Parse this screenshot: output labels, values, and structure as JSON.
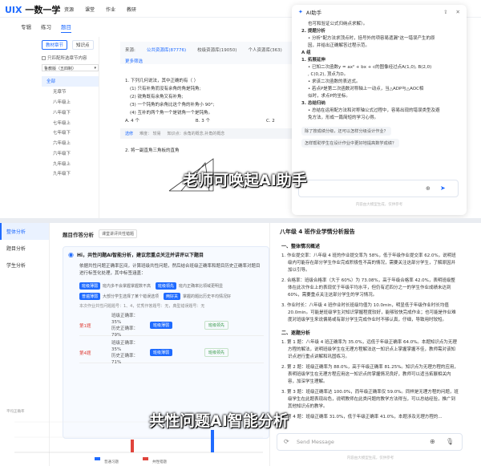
{
  "header": {
    "logo_mark": "UIX",
    "logo_text": "一数一学",
    "nav": [
      "资源",
      "课堂",
      "作业",
      "教研"
    ],
    "tabs": [
      "专辑",
      "练习",
      "题目"
    ]
  },
  "left_filter": {
    "subtabs": [
      "教材章节",
      "知识点"
    ],
    "only_matching": "只匹配所选章节内容",
    "edition": "鲁教版（五四制）",
    "tree": [
      "全部",
      "无章节",
      "八年级上",
      "八年级下",
      "七年级上",
      "七年级下",
      "六年级上",
      "六年级下",
      "九年级上",
      "九年级下"
    ]
  },
  "question_area": {
    "source_label": "来源:",
    "sources": [
      "公共资源库(87776)",
      "校级资源库(19050)",
      "个人资源库(363)"
    ],
    "more": "更多筛选",
    "q1": "1.  下列几何说法，其中正确的有（      ）",
    "q1_items": [
      "(1) 只有补角而没有余角的角是钝角;",
      "(2) 锐角既有余角又有补角;",
      "(3) 一个钝角的余角比这个角的补角小 90°;",
      "(4) 互补的两个角一个是锐角一个是钝角。"
    ],
    "q1_opts": [
      "A. 4 个",
      "B. 3 个",
      "C. 2"
    ],
    "q1_meta": [
      "选修",
      "难度：  较易",
      "知识点：余角的概念,补角的概念"
    ],
    "q2": "2.  将一副直角三角板的直角"
  },
  "ai_panel": {
    "title": "AI助手",
    "lines": [
      {
        "t": "也可和验证公式归纳点求解）。",
        "cls": "ind"
      },
      {
        "t": "2. 提题分析",
        "cls": "b"
      },
      {
        "t": "• 分析\"配方法求顶点时，括号外的项容易遗漏\"这一错误产生的原",
        "cls": "ind"
      },
      {
        "t": "因，并给出正确解答过程示范。",
        "cls": "ind"
      },
      {
        "t": "A 组",
        "cls": "b"
      },
      {
        "t": "1. 拓展延伸",
        "cls": "b"
      },
      {
        "t": "• 已知二次函数y = ax² + bx + c的图像经过点A(1,0), B(2,0)",
        "cls": "ind"
      },
      {
        "t": ", C(0,2), 顶点为D。",
        "cls": "ind"
      },
      {
        "t": "• 求该二次函数的表达式。",
        "cls": "ind"
      },
      {
        "t": "• 若点P是第二次函数对称轴上一动点，当△ADP与△AOC相",
        "cls": "ind"
      },
      {
        "t": "似时，求点P的坐标。",
        "cls": "ind"
      },
      {
        "t": "3. 总结归纳",
        "cls": "b"
      },
      {
        "t": "• 总结在运用配方法和对称轴公式过程中，容易出现的错误类型及避",
        "cls": "ind"
      },
      {
        "t": "免方法，形成一篇简短的学习心得。",
        "cls": "ind"
      }
    ],
    "suggestions": [
      "除了按成绩分级，还可以怎样分级设计作业？",
      "怎样帮助学生在设计作业中更好地提高数学成绩？"
    ],
    "footer": "内容由大模型生成，仅供参考"
  },
  "captions": {
    "top": "老师可唤起AI助手",
    "bottom": "共性问题AI智能分析"
  },
  "analysis": {
    "side": [
      "整体分析",
      "题目分析",
      "学生分析"
    ],
    "title": "题目作答分析",
    "pill": "课堂讲评共性错题",
    "ai_head": "Hi，共性问题AI智能分析，建议您重点关注并讲评以下题目",
    "intro": "依据共性问题正确率区间，计算班级共性问题，然后结合班级正确率和题目历史正确率对题目进行标签化处理，其中标签涵盖：",
    "chips": [
      {
        "t": "班级薄弱",
        "d": "班内多不会掌握掌握数不高"
      },
      {
        "t": "班级领先",
        "d": "班内正确率比领域更明显"
      },
      {
        "t": "普遍薄弱",
        "d": "大部分学生选择了某个错误选项"
      },
      {
        "t": "两好关",
        "d": "掌握的题比历史平均情况好"
      }
    ],
    "students": "本次作业共性问题题号：1、4，优秀作答题号：无，典型错误题号：无",
    "rows": [
      {
        "q": "第1题",
        "class": "班级正确率：35%",
        "hist": "历史正确率：79%",
        "b1": "班级薄弱",
        "b2": "班级领先"
      },
      {
        "q": "第4题",
        "class": "班级正确率：35%",
        "hist": "历史正确率：71%",
        "b1": "班级薄弱",
        "b2": "班级领先"
      }
    ],
    "chart_label": "平均正确率",
    "legend": [
      "普通习题",
      "共性错题"
    ]
  },
  "report": {
    "title": "八年级 4 班作业学情分析报告",
    "sections": [
      {
        "h": "一、整体情况概述",
        "items": [
          "1. 作业提交率：八年级 4 班的作业提交率为 58%，低于年级作业提交率 62.0%，说明班级内可能存在部分学生作业完成积极性不高的情况，需要关注这部分学生，了解原因并加以引导。",
          "2. 合格率：班级合格率（大于 60%）为 73.08%，高于年级合格率 42.0%，表明班级整体在此次作业上的表现优于年级平均水平，但仍有近四分之一的学生作业成绩未达到 60%，需要重点关注这部分学生的学习情况。",
          "3. 作业时长：八年级 4 班作业时长班级均值为 10.0min，明显低于年级作业时长均值 20.0min。可能是班级学生对知识掌握程度较好，能够较快完成作业；也可能是作业难度对班级学生来说偏易或有部分学生完成作业时不够认真，仔细，导致用时较短。"
        ]
      },
      {
        "h": "二、逐题分析",
        "items": [
          "1. 第 1 题：八年级 4 班正确率为 35.0%，远低于年级正确率 64.0%。本题知识点为无理方程的解法，说明班级学生在无理方程解法这一知识点上掌握掌握不佳，教师需对该知识点进行重点讲解和巩固练习。",
          "2. 第 2 题：班级正确率为 88.0%，高于年级正确率 81.25%。知识点为无理方程的应用，表明班级学生在无理方程应用这一知识点的掌握情况良好，教师可以适当拓展相关内容，加深学生理解。",
          "3. 第 3 题：班级正确率达 100.0%，而年级正确率仅 59.0%。同样是无理方程的问题，班级学生在此题表现出色，说明教师在此类问题的教学方法得当，可以总结经验，推广到其他知识点的教学。",
          "4. 第 4 题：班级正确率 31.0%，低于年级正确率 41.0%，本题涉及无理方程的..."
        ]
      }
    ],
    "input_placeholder": "Send Message",
    "footer": "内容由大模型生成，仅供参考"
  }
}
